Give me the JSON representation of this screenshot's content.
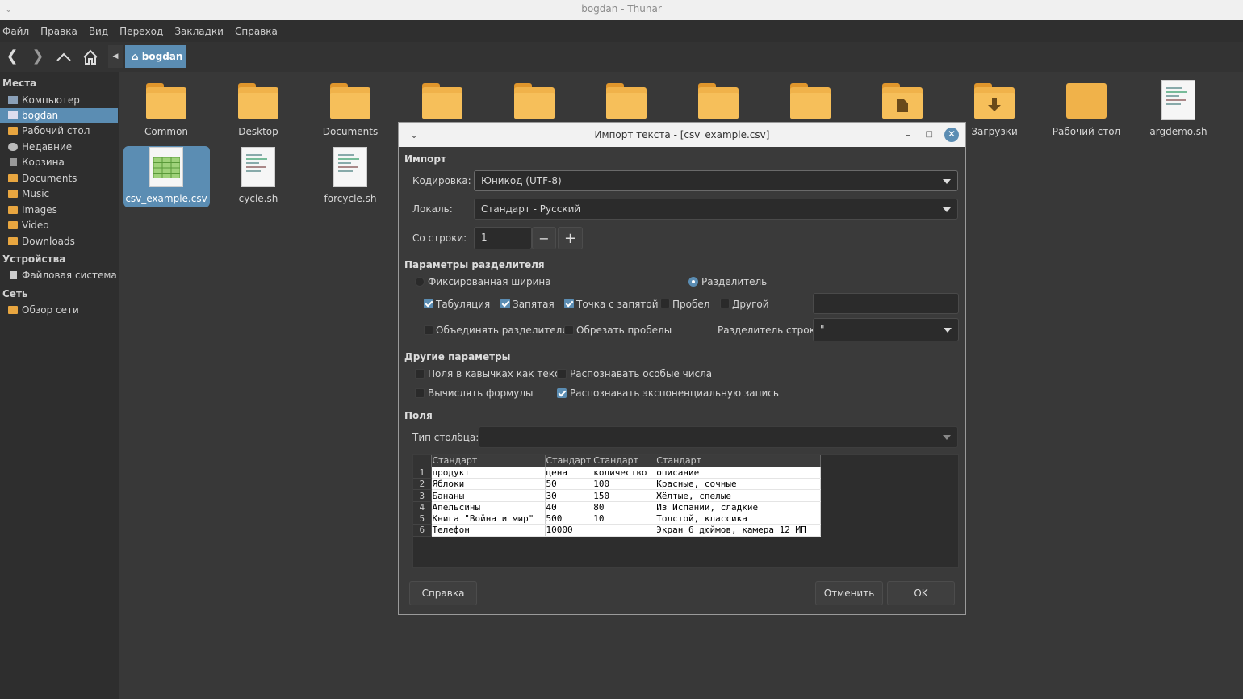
{
  "window": {
    "title": "bogdan - Thunar"
  },
  "menu": [
    "Файл",
    "Правка",
    "Вид",
    "Переход",
    "Закладки",
    "Справка"
  ],
  "path": {
    "current": "bogdan"
  },
  "sidebar": {
    "places_header": "Места",
    "places": [
      "Компьютер",
      "bogdan",
      "Рабочий стол",
      "Недавние",
      "Корзина",
      "Documents",
      "Music",
      "Images",
      "Video",
      "Downloads"
    ],
    "devices_header": "Устройства",
    "devices": [
      "Файловая система"
    ],
    "network_header": "Сеть",
    "network": [
      "Обзор сети"
    ]
  },
  "files": {
    "row1": [
      "Common",
      "Desktop",
      "Documents",
      "",
      "",
      "",
      "",
      "",
      "",
      "Загрузки",
      "Рабочий стол",
      "argdemo.sh"
    ],
    "row2": [
      "csv_example.csv",
      "cycle.sh",
      "forcycle.sh"
    ]
  },
  "dialog": {
    "title": "Импорт текста - [csv_example.csv]",
    "import_header": "Импорт",
    "encoding_label": "Кодировка:",
    "encoding_value": "Юникод (UTF-8)",
    "locale_label": "Локаль:",
    "locale_value": "Стандарт - Русский",
    "from_row_label": "Со строки:",
    "from_row_value": "1",
    "sep_header": "Параметры разделителя",
    "fixed_width": "Фиксированная ширина",
    "separated": "Разделитель",
    "tab": "Табуляция",
    "comma": "Запятая",
    "semicolon": "Точка с запятой",
    "space": "Пробел",
    "other": "Другой",
    "merge": "Объединять разделители",
    "trim": "Обрезать пробелы",
    "string_delim_label": "Разделитель строк:",
    "string_delim_value": "\"",
    "other_header": "Другие параметры",
    "quoted_as_text": "Поля в кавычках как текст",
    "detect_special": "Распознавать особые числа",
    "eval_formulas": "Вычислять формулы",
    "detect_sci": "Распознавать экспоненциальную запись",
    "fields_header": "Поля",
    "col_type_label": "Тип столбца:",
    "help_btn": "Справка",
    "cancel_btn": "Отменить",
    "ok_btn": "OK"
  },
  "preview": {
    "headers": [
      "Стандарт",
      "Стандарт",
      "Стандарт",
      "Стандарт"
    ],
    "rows": [
      [
        "1",
        "продукт",
        "цена",
        "количество",
        "описание"
      ],
      [
        "2",
        "Яблоки",
        "50",
        "100",
        "Красные, сочные"
      ],
      [
        "3",
        "Бананы",
        "30",
        "150",
        "Жёлтые, спелые"
      ],
      [
        "4",
        "Апельсины",
        "40",
        "80",
        "Из Испании, сладкие"
      ],
      [
        "5",
        "Книга \"Война и мир\"",
        "500",
        "10",
        "Толстой, классика"
      ],
      [
        "6",
        "Телефон",
        "10000",
        "",
        "Экран 6 дюймов, камера 12 МП"
      ]
    ]
  }
}
